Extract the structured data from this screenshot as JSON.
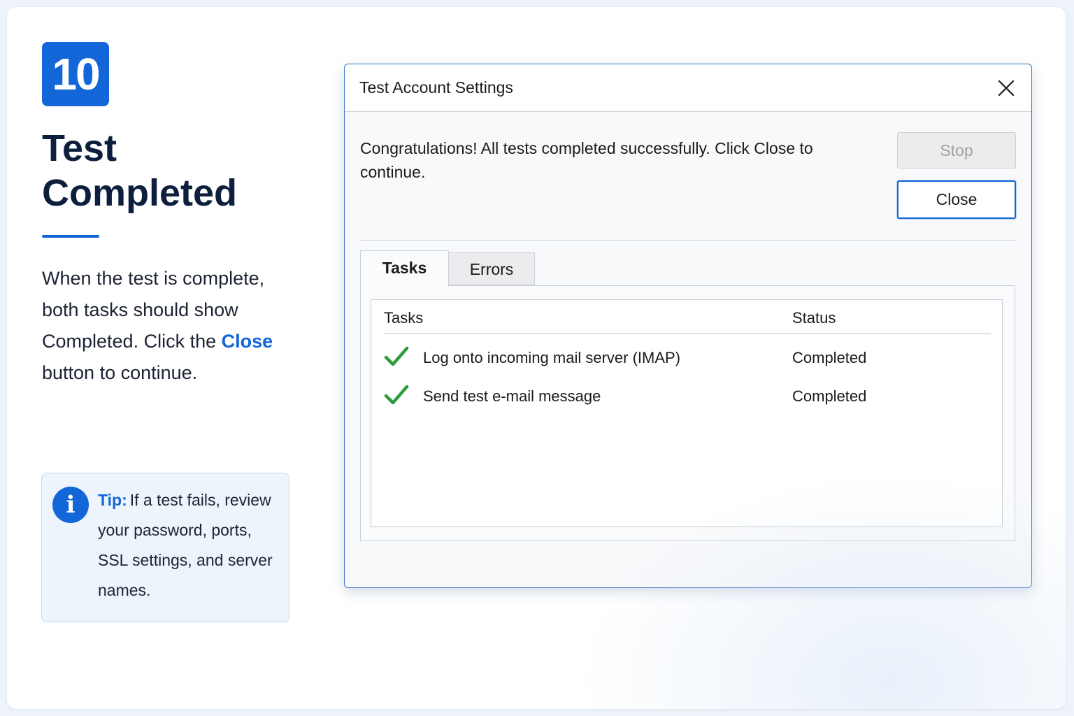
{
  "step": {
    "number": "10"
  },
  "heading": {
    "line1": "Test",
    "line2": "Completed"
  },
  "description": {
    "before": "When the test is complete, both tasks should show Completed. Click the ",
    "highlight": "Close",
    "after": " button to continue."
  },
  "tip": {
    "label": "Tip:",
    "text": "If a test fails, review your password, ports, SSL settings, and server names.",
    "icon": "info-icon"
  },
  "dialog": {
    "title": "Test Account Settings",
    "message": "Congratulations! All tests completed successfully. Click Close to continue.",
    "stop_label": "Stop",
    "close_label": "Close",
    "tabs": [
      {
        "label": "Tasks",
        "active": true
      },
      {
        "label": "Errors",
        "active": false
      }
    ],
    "columns": {
      "tasks": "Tasks",
      "status": "Status"
    },
    "rows": [
      {
        "task": "Log onto incoming mail server (IMAP)",
        "status": "Completed",
        "icon": "check-icon"
      },
      {
        "task": "Send test e-mail message",
        "status": "Completed",
        "icon": "check-icon"
      }
    ]
  },
  "colors": {
    "accent": "#1266d8",
    "heading": "#0e1f3d",
    "check": "#2e9a3a",
    "tip_background": "#eef4fc"
  }
}
